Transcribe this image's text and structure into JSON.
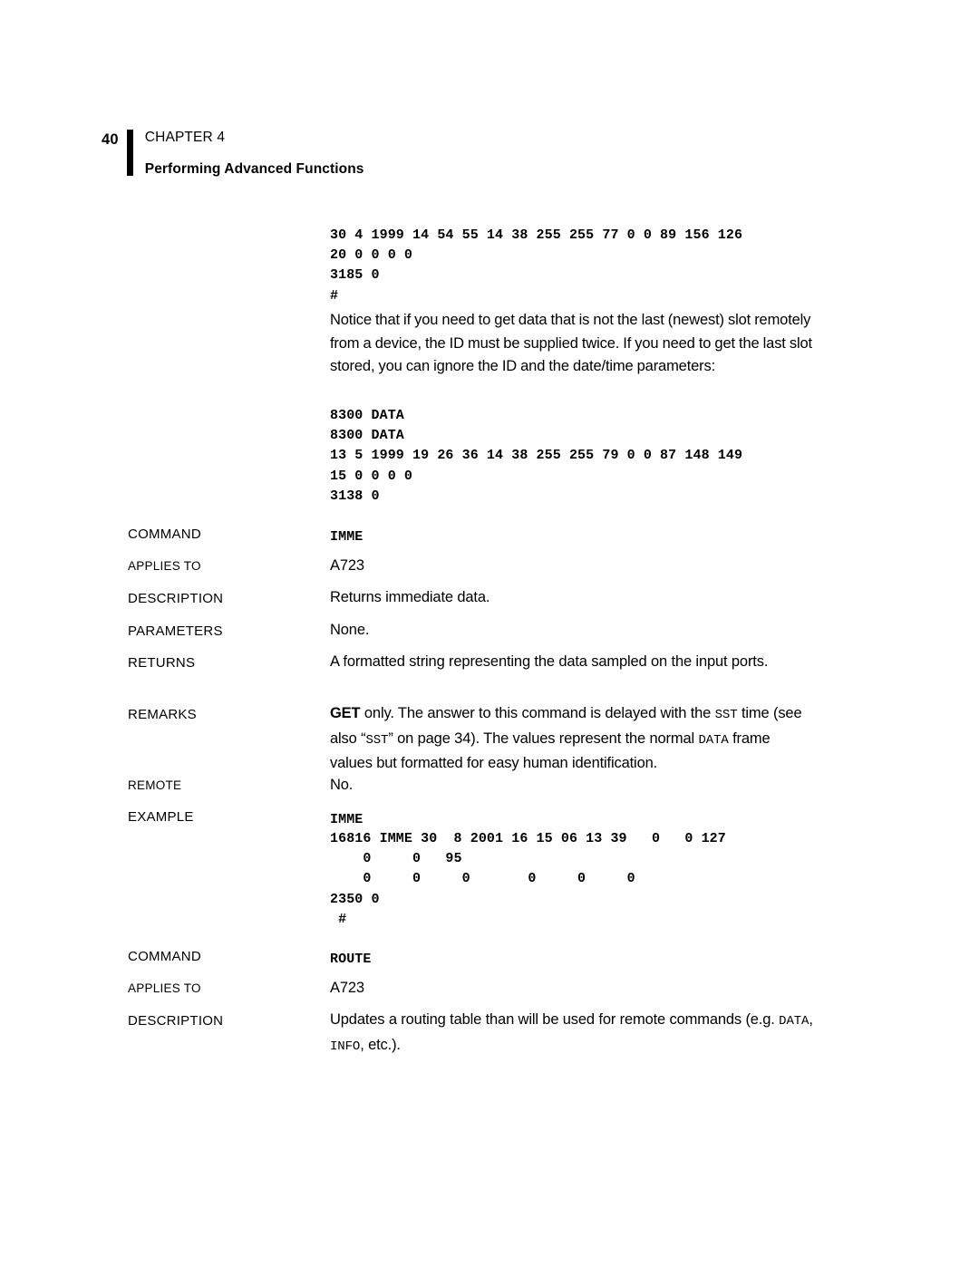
{
  "page": {
    "folio": "40",
    "chapter": "CHAPTER 4",
    "title": "Performing Advanced Functions"
  },
  "code_block_top": "30 4 1999 14 54 55 14 38 255 255 77 0 0 89 156 126\n20 0 0 0 0\n3185 0\n#",
  "notice_paragraph": "Notice that if you need to get data that is not the last (newest) slot remotely from a device, the ID must be supplied twice. If you need to get the last slot stored, you can ignore the ID and the date/time parameters:",
  "code_block_data": "8300 DATA\n8300 DATA\n13 5 1999 19 26 36 14 38 255 255 79 0 0 87 148 149\n15 0 0 0 0\n3138 0",
  "labels": {
    "command": "COMMAND",
    "applies_to": "APPLIES TO",
    "description": "DESCRIPTION",
    "parameters": "PARAMETERS",
    "returns": "RETURNS",
    "remarks": "REMARKS",
    "remote": "REMOTE",
    "example": "EXAMPLE"
  },
  "imme": {
    "command": "IMME",
    "applies_to": "A723",
    "description": "Returns immediate data.",
    "parameters": "None.",
    "returns": "A formatted string representing the data sampled on the input ports.",
    "remarks": {
      "get": "GET",
      "part1": " only. The answer to this command is delayed with the ",
      "sst1": "SST",
      "part2": " time (see also “",
      "sst2": "SST",
      "part3": "” on page 34). The values represent the normal ",
      "data": "DATA",
      "part4": " frame values but formatted for easy human identification."
    },
    "remote": "No.",
    "example_title": "IMME",
    "example_code": "16816 IMME 30  8 2001 16 15 06 13 39   0   0 127\n    0     0   95\n    0     0     0       0     0     0\n2350 0\n #"
  },
  "route": {
    "command": "ROUTE",
    "applies_to": "A723",
    "description": {
      "part1": "Updates a routing table than will be used for remote commands (e.g. ",
      "data": "DATA",
      "part2": ", ",
      "info": "INFO",
      "part3": ", etc.)."
    }
  }
}
